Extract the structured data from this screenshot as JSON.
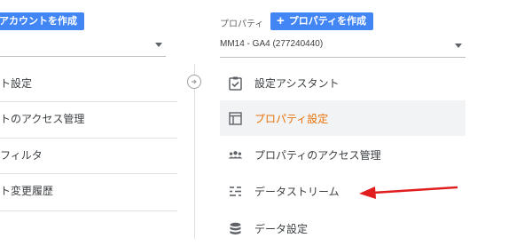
{
  "account": {
    "create_button_label": "アカウントを作成",
    "menu_items": [
      {
        "label": "ト設定"
      },
      {
        "label": "トのアクセス管理"
      },
      {
        "label": "フィルタ"
      },
      {
        "label": "ト変更履歴"
      }
    ]
  },
  "property": {
    "section_label": "プロパティ",
    "create_button_plus": "+",
    "create_button_label": "プロパティを作成",
    "selected": "MM14 - GA4 (277240440)",
    "menu_items": [
      {
        "label": "設定アシスタント",
        "icon": "checklist-icon"
      },
      {
        "label": "プロパティ設定",
        "icon": "layout-icon",
        "active": true
      },
      {
        "label": "プロパティのアクセス管理",
        "icon": "people-icon"
      },
      {
        "label": "データストリーム",
        "icon": "data-streams-icon"
      },
      {
        "label": "データ設定",
        "icon": "database-icon"
      }
    ]
  },
  "colors": {
    "primary_blue": "#4285f4",
    "active_orange": "#e8710a",
    "arrow_red": "#e01e1e",
    "icon_gray": "#5f6368"
  }
}
